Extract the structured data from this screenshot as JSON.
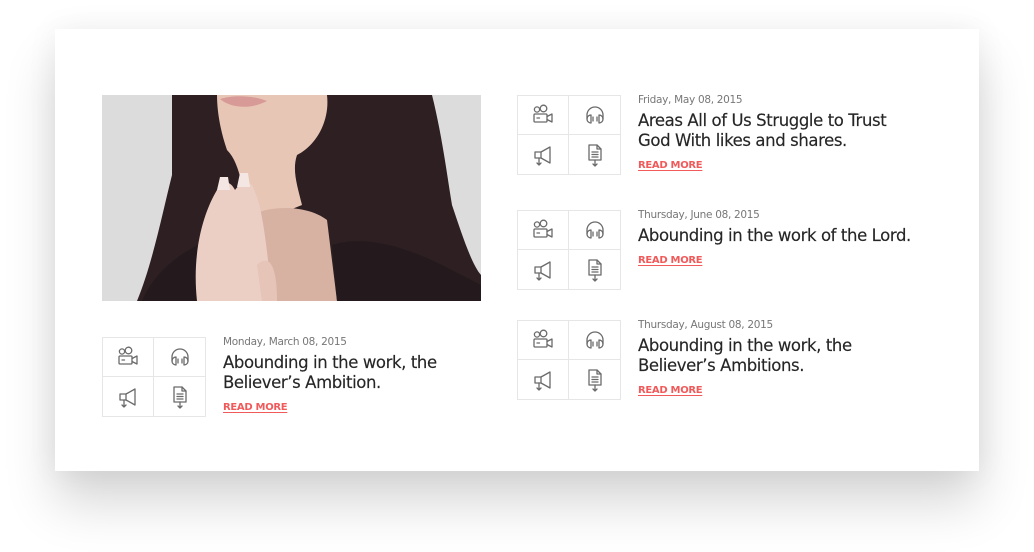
{
  "featured_image": {
    "alt": "Woman with long dark hair holding hands together in prayer"
  },
  "icon_grid": {
    "icons": [
      "video-icon",
      "headphones-icon",
      "megaphone-icon",
      "document-download-icon"
    ]
  },
  "posts": [
    {
      "date": "Monday, March 08, 2015",
      "title": "Abounding in the work, the Believer’s Ambition.",
      "link_label": "READ MORE"
    },
    {
      "date": "Friday, May 08, 2015",
      "title": "Areas All of Us Struggle to Trust God With likes and shares.",
      "link_label": "READ MORE"
    },
    {
      "date": "Thursday, June 08, 2015",
      "title": "Abounding in the work of the Lord.",
      "link_label": "READ MORE"
    },
    {
      "date": "Thursday, August 08, 2015",
      "title": "Abounding in the work, the Believer’s Ambitions.",
      "link_label": "READ MORE"
    }
  ],
  "colors": {
    "accent": "#f05a5a",
    "title": "#262626",
    "date": "#777777",
    "border": "#e6e6e6",
    "icon": "#6a6a6a"
  }
}
